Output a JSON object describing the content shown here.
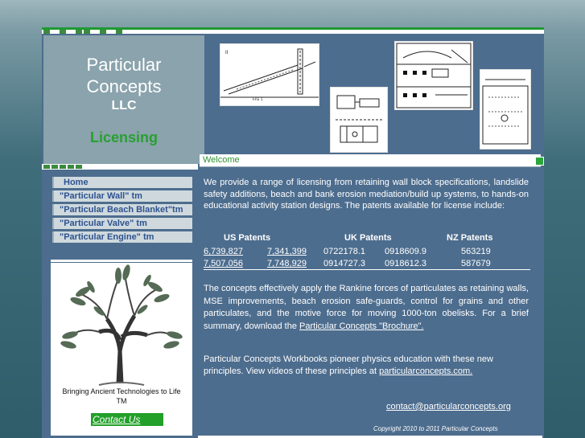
{
  "brand": {
    "line1": "Particular",
    "line2": "Concepts",
    "llc": "LLC",
    "section": "Licensing"
  },
  "nav": {
    "items": [
      {
        "label": "Home"
      },
      {
        "label": "\"Particular Wall\" tm"
      },
      {
        "label": "\"Particular Beach Blanket\"tm"
      },
      {
        "label": "\"Particular Valve\" tm"
      },
      {
        "label": "\"Particular Engine\" tm"
      }
    ]
  },
  "sidebar": {
    "caption_line1": "Bringing Ancient Technologies to Life",
    "caption_line2": "TM",
    "contact_label": "Contact Us"
  },
  "content": {
    "heading": "Welcome",
    "intro": "We provide a range of licensing from  retaining wall block specifications, landslide safety additions, beach and bank erosion mediation/build up systems, to hands-on educational activity station designs. The patents available for license include:",
    "patents": {
      "us_header": "US  Patents",
      "uk_header": "UK Patents",
      "nz_header": "NZ Patents",
      "rows": [
        {
          "us1": "6,739,827",
          "us2": "7,341,399",
          "uk1": "0722178.1",
          "uk2": "0918609.9",
          "nz": "563219"
        },
        {
          "us1": "7,507,056",
          "us2": "7,748,929",
          "uk1": "0914727.3",
          "uk2": "0918612.3",
          "nz": "587679"
        }
      ]
    },
    "para2_text": "The concepts effectively apply the Rankine forces of particulates as retaining walls, MSE improvements, beach erosion safe-guards, control for grains and other particulates, and the motive force for moving 1000-ton obelisks.    For a brief summary, download the ",
    "para2_link": "Particular Concepts \"Brochure\".",
    "para3_text": "Particular Concepts Workbooks pioneer physics education with these new principles.  View videos of these principles at ",
    "para3_link": "particularconcepts.com.",
    "email": "contact@particularconcepts.org",
    "copyright": "Copyright 2010 to 2011  Particular Concepts"
  },
  "colors": {
    "panel": "#4d6d8e",
    "accent_green": "#28a030",
    "nav_text": "#2d5290",
    "nav_bg": "#cfd9dd"
  }
}
